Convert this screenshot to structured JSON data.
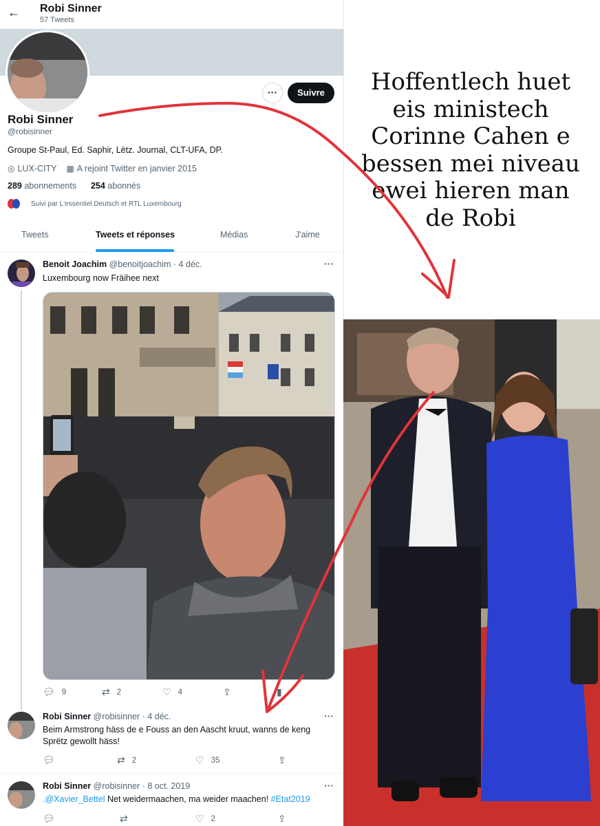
{
  "profile": {
    "header_name": "Robi Sinner",
    "tweet_count": "57 Tweets",
    "name": "Robi Sinner",
    "handle": "@robisinner",
    "bio": "Groupe St-Paul, Ed. Saphir, Lëtz. Journal, CLT-UFA, DP.",
    "location": "LUX-CITY",
    "joined": "A rejoint Twitter en janvier 2015",
    "following_count": "289",
    "following_label": "abonnements",
    "followers_count": "254",
    "followers_label": "abonnés",
    "followed_by": "Suivi par L'essentiel Deutsch et RTL Luxembourg",
    "follow_button": "Suivre",
    "more_button": "···"
  },
  "tabs": [
    {
      "label": "Tweets"
    },
    {
      "label": "Tweets et réponses"
    },
    {
      "label": "Médias"
    },
    {
      "label": "J'aime"
    }
  ],
  "tweets": [
    {
      "name": "Benoit Joachim",
      "handle": "@benoitjoachim",
      "date": "· 4 déc.",
      "text": "Luxembourg now Fräihee next",
      "replies": "9",
      "retweets": "2",
      "likes": "4"
    },
    {
      "name": "Robi Sinner",
      "handle": "@robisinner",
      "date": "· 4 déc.",
      "text": "Beim Armstrong häss de e Fouss an den Aascht kruut, wanns de keng Sprëtz gewollt häss!",
      "replies": "",
      "retweets": "2",
      "likes": "35"
    },
    {
      "name": "Robi Sinner",
      "handle": "@robisinner",
      "date": "· 8 oct. 2019",
      "mention": ".@Xavier_Bettel",
      "text": " Net weidermaachen, ma weider maachen! ",
      "hashtag": "#Etat2019",
      "replies": "",
      "retweets": "",
      "likes": "2"
    }
  ],
  "caption": {
    "lines": [
      "Hoffentlech huet",
      "eis ministech",
      "Corinne Cahen e",
      "bessen mei niveau",
      "ewei hieren man",
      "de Robi"
    ]
  },
  "icons": {
    "back": "arrow-left-icon",
    "location": "location-pin-icon",
    "calendar": "calendar-icon",
    "reply": "reply-icon",
    "retweet": "retweet-icon",
    "like": "heart-icon",
    "share": "share-icon",
    "analytics": "analytics-icon"
  },
  "colors": {
    "accent": "#1d9bf0",
    "annotation_red": "#e0343a",
    "banner": "#cfd9de"
  }
}
